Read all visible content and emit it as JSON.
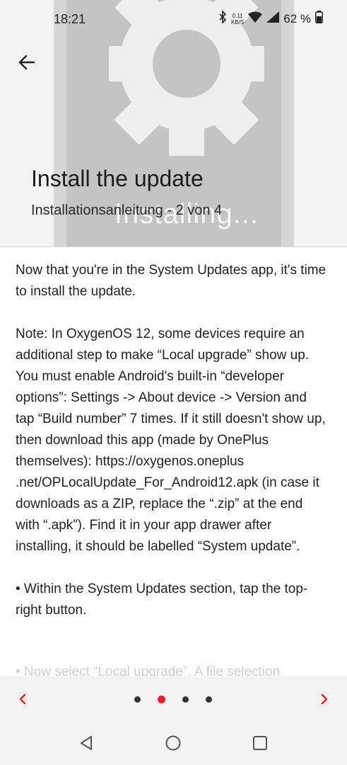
{
  "status_bar": {
    "time": "18:21",
    "net_speed_value": "0.11",
    "net_speed_unit": "KB/S",
    "battery": "62 %"
  },
  "header": {
    "hero_text": "Installing...",
    "title": "Install the update",
    "subtitle": "Installationsanleitung - 2 von 4"
  },
  "content": {
    "paragraphs": [
      "Now that you're in the System Updates app, it's time to install the update.",
      "Note: In OxygenOS 12, some devices require an additional step to make “Local upgrade” show up. You must enable Android's built-in “developer options”: Settings -> About device -> Version and tap “Build number” 7 times. If it still doesn't show up, then download this app (made by OnePlus themselves): https://oxygenos.oneplus .net/OPLocalUpdate_For_Android12.apk (in case it downloads as a ZIP, replace the “.zip” at the end with “.apk”). Find it in your app drawer after installing, it should be labelled “System update”.",
      "• Within the System Updates section, tap the top-right button."
    ],
    "faded_line": "• Now select “Local upgrade”. A file selection"
  },
  "pager": {
    "total_pages": 4,
    "current_page": 2
  },
  "colors": {
    "accent": "#e0202a",
    "header_bg": "#f3f3f3",
    "hero_gray": "#c4c4c4"
  },
  "icons": {
    "back": "arrow-left-icon",
    "prev": "chevron-left-icon",
    "next": "chevron-right-icon",
    "nav_back": "triangle-back-icon",
    "nav_home": "circle-home-icon",
    "nav_recents": "square-recents-icon"
  }
}
